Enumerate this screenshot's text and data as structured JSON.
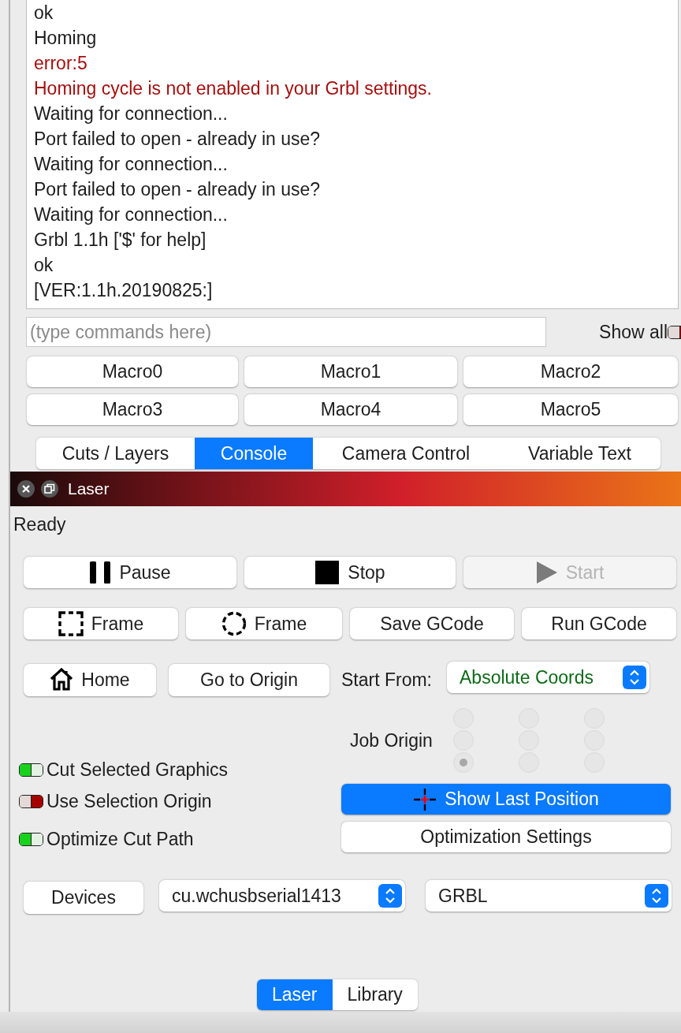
{
  "console": {
    "lines": [
      {
        "text": "ok",
        "kind": "normal"
      },
      {
        "text": "Homing",
        "kind": "normal"
      },
      {
        "text": "error:5",
        "kind": "error"
      },
      {
        "text": "Homing cycle is not enabled in your Grbl settings.",
        "kind": "error"
      },
      {
        "text": "Waiting for connection...",
        "kind": "normal"
      },
      {
        "text": "Port failed to open - already in use?",
        "kind": "normal"
      },
      {
        "text": "Waiting for connection...",
        "kind": "normal"
      },
      {
        "text": "Port failed to open - already in use?",
        "kind": "normal"
      },
      {
        "text": "Waiting for connection...",
        "kind": "normal"
      },
      {
        "text": "Grbl 1.1h ['$' for help]",
        "kind": "normal"
      },
      {
        "text": "ok",
        "kind": "normal"
      },
      {
        "text": "[VER:1.1h.20190825:]",
        "kind": "normal"
      }
    ],
    "command_placeholder": "(type commands here)",
    "show_all": {
      "label": "Show all",
      "on": false
    },
    "macros": [
      "Macro0",
      "Macro1",
      "Macro2",
      "Macro3",
      "Macro4",
      "Macro5"
    ]
  },
  "tabs": [
    {
      "label": "Cuts / Layers",
      "selected": false
    },
    {
      "label": "Console",
      "selected": true
    },
    {
      "label": "Camera Control",
      "selected": false
    },
    {
      "label": "Variable Text",
      "selected": false
    }
  ],
  "laser": {
    "title": "Laser",
    "status": "Ready",
    "run_buttons": [
      {
        "label": "Pause",
        "kind": "pause",
        "disabled": false
      },
      {
        "label": "Stop",
        "kind": "stop",
        "disabled": false
      },
      {
        "label": "Start",
        "kind": "start",
        "disabled": true
      }
    ],
    "gcode_buttons": [
      {
        "label": "Frame",
        "kind": "rect"
      },
      {
        "label": "Frame",
        "kind": "circle"
      },
      {
        "label": "Save GCode",
        "kind": "text"
      },
      {
        "label": "Run GCode",
        "kind": "text"
      }
    ],
    "home_button": "Home",
    "origin_button": "Go to Origin",
    "start_from": {
      "label": "Start From:",
      "value": "Absolute Coords"
    },
    "job_origin": {
      "label": "Job Origin",
      "positions": [
        {
          "selected": false
        },
        {
          "selected": false
        },
        {
          "selected": false
        },
        {
          "selected": false
        },
        {
          "selected": false
        },
        {
          "selected": false
        },
        {
          "selected": true
        },
        {
          "selected": false
        },
        {
          "selected": false
        }
      ]
    },
    "options": [
      {
        "label": "Cut Selected Graphics",
        "on": true
      },
      {
        "label": "Use Selection Origin",
        "on": false
      },
      {
        "label": "Optimize Cut Path",
        "on": true
      }
    ],
    "show_last_position": "Show Last Position",
    "optimization_settings": "Optimization Settings",
    "devices_button": "Devices",
    "port": "cu.wchusbserial1413",
    "controller": "GRBL"
  },
  "bottom_tabs": [
    {
      "label": "Laser",
      "selected": true
    },
    {
      "label": "Library",
      "selected": false
    }
  ]
}
